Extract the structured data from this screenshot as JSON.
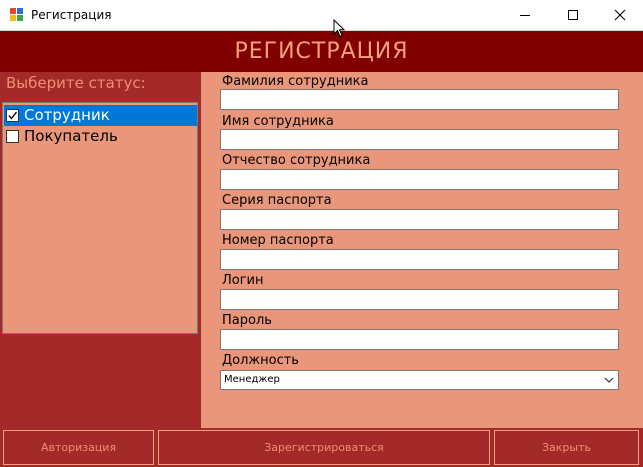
{
  "window": {
    "title": "Регистрация",
    "controls": [
      "minimize-icon",
      "maximize-icon",
      "close-icon"
    ]
  },
  "header": {
    "title": "РЕГИСТРАЦИЯ"
  },
  "status": {
    "label": "Выберите статус:",
    "items": [
      {
        "label": "Сотрудник",
        "checked": true,
        "selected": true
      },
      {
        "label": "Покупатель",
        "checked": false,
        "selected": false
      }
    ]
  },
  "form": {
    "fields": [
      {
        "label": "Фамилия сотрудника",
        "value": ""
      },
      {
        "label": "Имя сотрудника",
        "value": ""
      },
      {
        "label": "Отчество сотрудника",
        "value": ""
      },
      {
        "label": "Серия паспорта",
        "value": ""
      },
      {
        "label": "Номер паспорта",
        "value": ""
      },
      {
        "label": "Логин",
        "value": ""
      },
      {
        "label": "Пароль",
        "value": ""
      }
    ],
    "position": {
      "label": "Должность",
      "selected": "Менеджер"
    }
  },
  "buttons": {
    "auth": "Авторизация",
    "register": "Зарегистрироваться",
    "close": "Закрыть"
  },
  "colors": {
    "header_bg": "#800000",
    "panel_dark": "#a42929",
    "panel_light": "#e9967a",
    "accent_text": "#f4a27b",
    "selection": "#0078d7"
  }
}
